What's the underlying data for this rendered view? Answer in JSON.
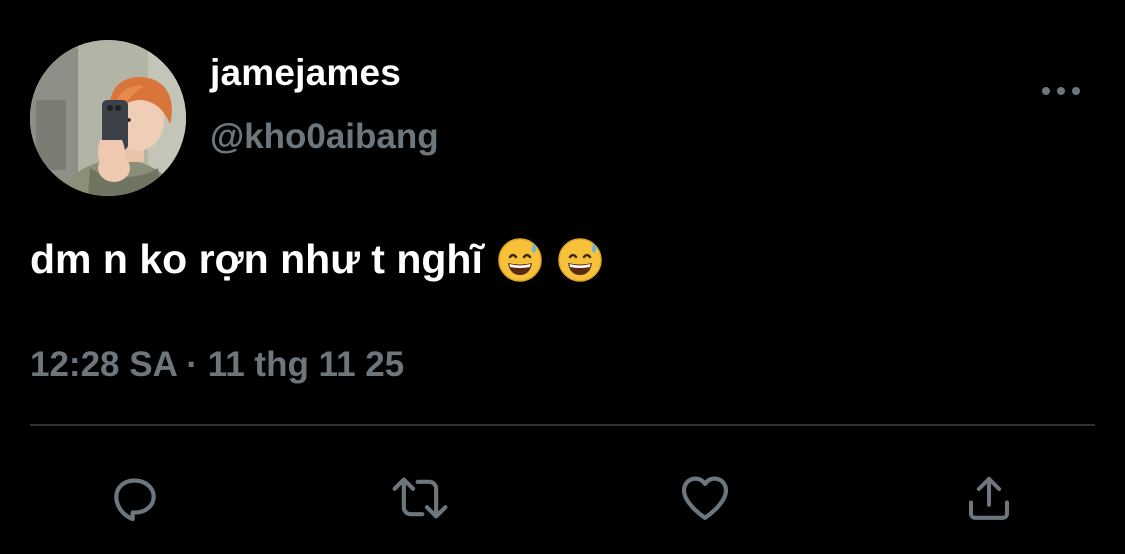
{
  "tweet": {
    "display_name": "jamejames",
    "handle": "@kho0aibang",
    "text": "dm n ko rợn như t nghĩ",
    "emojis": [
      "grinning-face-with-sweat",
      "grinning-face-with-sweat"
    ],
    "time": "12:28 SA",
    "separator": "·",
    "date": "11 thg 11 25"
  },
  "actions": {
    "reply_icon": "reply-icon",
    "retweet_icon": "retweet-icon",
    "like_icon": "heart-icon",
    "share_icon": "share-icon",
    "more_icon": "more-icon"
  },
  "colors": {
    "background": "#000000",
    "primary_text": "#ffffff",
    "secondary_text": "#6e767d",
    "divider": "#2f3336"
  }
}
